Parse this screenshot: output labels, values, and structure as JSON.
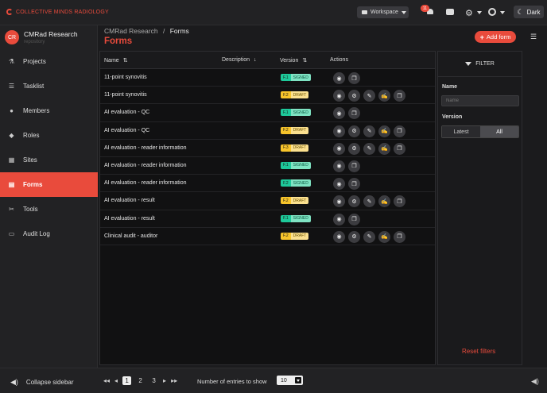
{
  "brand": {
    "name": "COLLECTIVE MINDS RADIOLOGY",
    "color": "#e94b3c"
  },
  "topbar": {
    "workspace_label": "Workspace",
    "notifications_count": "11",
    "theme_label": "Dark"
  },
  "sidebar": {
    "org_initials": "CR",
    "org_name": "CMRad Research",
    "org_sub": "repository",
    "items": [
      {
        "label": "Projects",
        "icon": "flask-icon",
        "glyph": "⚗"
      },
      {
        "label": "Tasklist",
        "icon": "list-icon",
        "glyph": "☰"
      },
      {
        "label": "Members",
        "icon": "user-icon",
        "glyph": "●"
      },
      {
        "label": "Roles",
        "icon": "users-icon",
        "glyph": "◆"
      },
      {
        "label": "Sites",
        "icon": "building-icon",
        "glyph": "▦"
      },
      {
        "label": "Forms",
        "icon": "form-icon",
        "glyph": "▤",
        "active": true
      },
      {
        "label": "Tools",
        "icon": "tools-icon",
        "glyph": "✂"
      },
      {
        "label": "Audit Log",
        "icon": "audit-icon",
        "glyph": "▭"
      }
    ],
    "collapse_label": "Collapse sidebar"
  },
  "breadcrumb": {
    "parent": "CMRad Research",
    "separator": "/",
    "current": "Forms"
  },
  "page_title": "Forms",
  "add_button": "Add form",
  "table": {
    "columns": {
      "name": "Name",
      "description": "Description",
      "version": "Version",
      "actions": "Actions"
    },
    "rows": [
      {
        "name": "11-point synovitis",
        "version": "F.1",
        "status": "SIGNED",
        "kind": "signed",
        "actions": [
          "view-icon",
          "copy-icon"
        ]
      },
      {
        "name": "11-point synovitis",
        "version": "F.2",
        "status": "DRAFT",
        "kind": "draft",
        "actions": [
          "view-icon",
          "gear-icon",
          "edit-icon",
          "sign-icon",
          "copy-icon"
        ]
      },
      {
        "name": "AI evaluation - QC",
        "version": "F.1",
        "status": "SIGNED",
        "kind": "signed",
        "actions": [
          "view-icon",
          "copy-icon"
        ]
      },
      {
        "name": "AI evaluation - QC",
        "version": "F.2",
        "status": "DRAFT",
        "kind": "draft",
        "actions": [
          "view-icon",
          "gear-icon",
          "edit-icon",
          "sign-icon",
          "copy-icon"
        ]
      },
      {
        "name": "AI evaluation - reader information",
        "version": "F.3",
        "status": "DRAFT",
        "kind": "draft",
        "actions": [
          "view-icon",
          "gear-icon",
          "edit-icon",
          "sign-icon",
          "copy-icon"
        ]
      },
      {
        "name": "AI evaluation - reader information",
        "version": "F.1",
        "status": "SIGNED",
        "kind": "signed",
        "actions": [
          "view-icon",
          "copy-icon"
        ]
      },
      {
        "name": "AI evaluation - reader information",
        "version": "F.2",
        "status": "SIGNED",
        "kind": "signed",
        "actions": [
          "view-icon",
          "copy-icon"
        ]
      },
      {
        "name": "AI evaluation - result",
        "version": "F.2",
        "status": "DRAFT",
        "kind": "draft",
        "actions": [
          "view-icon",
          "gear-icon",
          "edit-icon",
          "sign-icon",
          "copy-icon"
        ]
      },
      {
        "name": "AI evaluation - result",
        "version": "F.1",
        "status": "SIGNED",
        "kind": "signed",
        "actions": [
          "view-icon",
          "copy-icon"
        ]
      },
      {
        "name": "Clinical audit - auditor",
        "version": "F.2",
        "status": "DRAFT",
        "kind": "draft",
        "actions": [
          "view-icon",
          "gear-icon",
          "edit-icon",
          "sign-icon",
          "copy-icon"
        ]
      }
    ]
  },
  "filter": {
    "title": "FILTER",
    "name_label": "Name",
    "name_placeholder": "Name",
    "version_label": "Version",
    "version_options": [
      "Latest",
      "All"
    ],
    "version_selected": "All",
    "reset_label": "Reset filters"
  },
  "pagination": {
    "pages": [
      "1",
      "2",
      "3"
    ],
    "current": "1",
    "entries_label": "Number of entries to show",
    "entries_value": "10"
  }
}
